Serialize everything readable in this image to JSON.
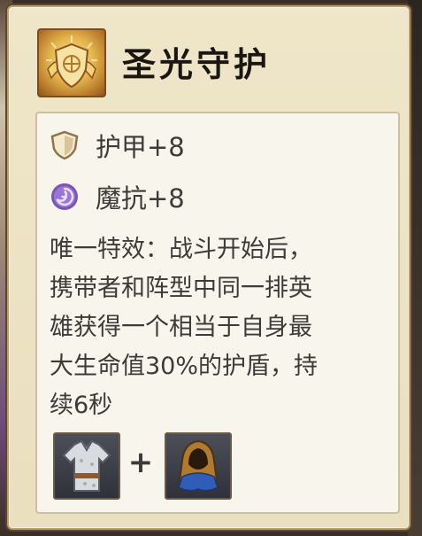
{
  "item": {
    "name": "圣光守护",
    "icon": "holy-shield-emblem-icon"
  },
  "stats": [
    {
      "icon": "armor-shield-icon",
      "label": "护甲+8"
    },
    {
      "icon": "magic-resist-swirl-icon",
      "label": "魔抗+8"
    }
  ],
  "description": "唯一特效：战斗开始后，\n携带者和阵型中同一排英\n雄获得一个相当于自身最\n大生命值30%的护盾，持\n续6秒",
  "recipe": {
    "components": [
      {
        "icon": "cloth-tunic-icon"
      },
      {
        "icon": "hooded-cloak-icon"
      }
    ],
    "plus": "+"
  },
  "colors": {
    "tooltip_bg": "#efe6c9",
    "panel_bg": "#f8f5ec",
    "text": "#3d3a37",
    "title": "#1b1611",
    "gold": "#e5b54d"
  }
}
